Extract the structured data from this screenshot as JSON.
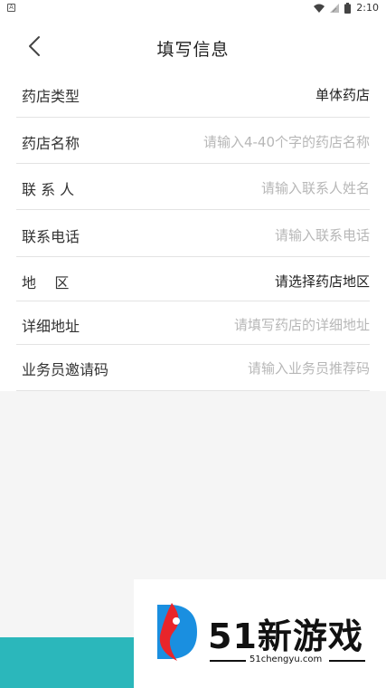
{
  "status_bar": {
    "left_icon": "notification-icon",
    "time": "2:10",
    "icons": [
      "wifi-icon",
      "signal-icon",
      "battery-icon"
    ]
  },
  "header": {
    "title": "填写信息",
    "back_icon": "chevron-left-icon"
  },
  "form": {
    "rows": [
      {
        "label": "药店类型",
        "value": "单体药店",
        "filled": true
      },
      {
        "label": "药店名称",
        "placeholder": "请输入4-40个字的药店名称"
      },
      {
        "label": "联 系 人",
        "placeholder": "请输入联系人姓名"
      },
      {
        "label": "联系电话",
        "placeholder": "请输入联系电话"
      },
      {
        "label": "地    区",
        "value": "请选择药店地区",
        "filled": true
      },
      {
        "label": "详细地址",
        "placeholder": "请填写药店的详细地址"
      },
      {
        "label": "业务员邀请码",
        "placeholder": "请输入业务员推荐码"
      }
    ]
  },
  "watermark": {
    "brand": "51新游戏",
    "url": "51chengyu.com"
  },
  "colors": {
    "accent": "#2bb7bb",
    "placeholder": "#b7b7b7",
    "divider": "#e3e3e3"
  }
}
